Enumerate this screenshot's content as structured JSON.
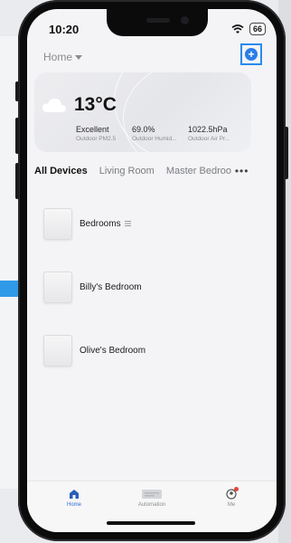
{
  "status_bar": {
    "time": "10:20",
    "battery": "66"
  },
  "header": {
    "home_label": "Home",
    "add_icon": "plus-circle-icon"
  },
  "weather": {
    "temperature": "13°C",
    "icon": "cloud-icon",
    "metrics": [
      {
        "value": "Excellent",
        "label": "Outdoor PM2.5"
      },
      {
        "value": "69.0%",
        "label": "Outdoor Humid..."
      },
      {
        "value": "1022.5hPa",
        "label": "Outdoor Air Pr..."
      }
    ]
  },
  "tabs": [
    "All Devices",
    "Living Room",
    "Master Bedroo"
  ],
  "rooms": [
    {
      "name": "Bedrooms",
      "group_icon": "group-icon"
    },
    {
      "name": "Billy's Bedroom"
    },
    {
      "name": "Olive's Bedroom"
    }
  ],
  "bottom_nav": [
    {
      "label": "Home",
      "icon": "home-icon"
    },
    {
      "label": "Automation",
      "icon": "automation-icon"
    },
    {
      "label": "Me",
      "icon": "profile-icon"
    }
  ],
  "colors": {
    "accent": "#2b7ee8",
    "highlight": "#2a8af0",
    "badge": "#e8453c"
  }
}
